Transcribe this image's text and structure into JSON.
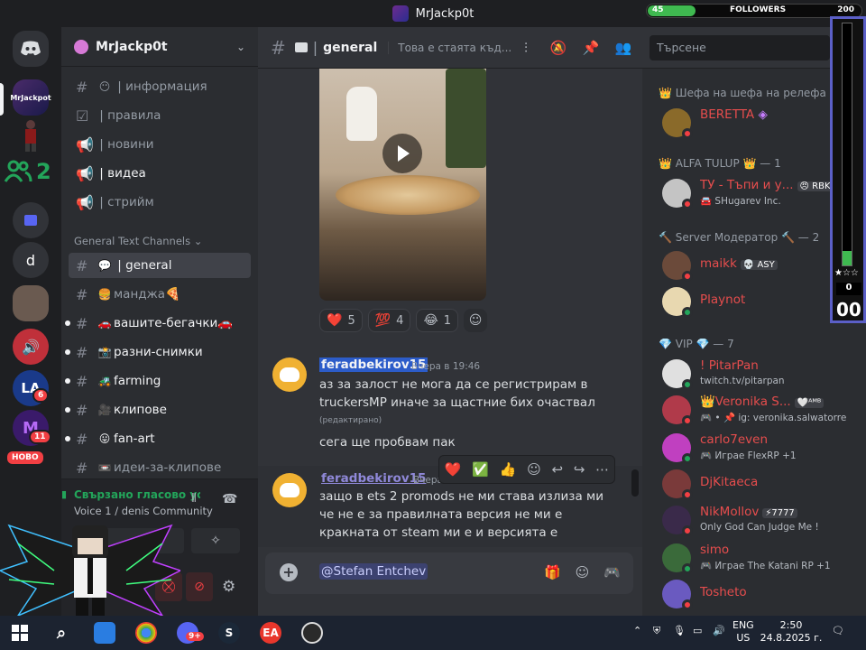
{
  "window": {
    "title": "MrJackp0t"
  },
  "followers_widget": {
    "current": "45",
    "label": "FOLLOWERS",
    "goal": "200",
    "progress": 0.225
  },
  "rail": {
    "servers": [
      {
        "name": "discord-home",
        "label": ""
      },
      {
        "name": "mrjackpot-server",
        "label": "MrJackpot"
      },
      {
        "name": "folder",
        "label": ""
      },
      {
        "name": "d-server",
        "label": "d"
      }
    ],
    "voice_count": "2",
    "badges": [
      "6",
      "11"
    ],
    "new_label": "НОВО"
  },
  "sidebar": {
    "guild_name": "MrJackp0t",
    "top_channels": [
      {
        "emoji": "😶",
        "label": "информация"
      },
      {
        "emoji": "☑",
        "label": "правила"
      },
      {
        "emoji": "📢",
        "label": "новини"
      },
      {
        "emoji": "📢",
        "label": "видеа"
      },
      {
        "emoji": "📢",
        "label": "стрийм"
      }
    ],
    "category": "General Text Channels",
    "text_channels": [
      {
        "emoji": "💬",
        "label": "general"
      },
      {
        "emoji": "🍔",
        "label": "манджа🍕"
      },
      {
        "emoji": "🚗",
        "label": "вашите-бегачки🚗"
      },
      {
        "emoji": "📸",
        "label": "разни-снимки"
      },
      {
        "emoji": "🚜",
        "label": "farming"
      },
      {
        "emoji": "🎥",
        "label": "клипове"
      },
      {
        "emoji": "😛",
        "label": "fan-art"
      },
      {
        "emoji": "📼",
        "label": "идеи-за-клипове"
      }
    ],
    "voice_status": "Свързано гласово устр",
    "voice_channel": "Voice 1 / denis Community"
  },
  "chat_header": {
    "channel": "general",
    "topic": "Това е стаята къд...",
    "search_placeholder": "Търсене"
  },
  "messages": {
    "reactions": [
      {
        "emoji": "❤️",
        "count": "5"
      },
      {
        "emoji": "💯",
        "count": "4"
      },
      {
        "emoji": "😂",
        "count": "1"
      }
    ],
    "m1": {
      "author": "feradbekirov15",
      "time": "Вчера в 19:46",
      "text": "аз за залост не мога да се регистрирам в truckersMP иначе за щастние бих очаствал",
      "edited": "(редактирано)",
      "text2": "сега ще пробвам пак"
    },
    "m2": {
      "author": "feradbekirov15",
      "time": "Вчера",
      "text": "защо в ets 2 promods не ми става излиза ми че не е за правилната версия не ми е кракната от steam ми е и версията е правилна"
    }
  },
  "composer": {
    "mention": "@Stefan Entchev"
  },
  "member_list": {
    "categories": [
      {
        "label": "👑 Шефа на шефа на релефа 👑"
      },
      {
        "label": "👑 ALFA TULUP 👑 — 1"
      },
      {
        "label": "🔨 Server Модератор 🔨 — 2"
      },
      {
        "label": "💎 VIP 💎 — 7"
      }
    ],
    "members": [
      {
        "name": "BERETTA",
        "sub": "",
        "tag": "",
        "avatar": "#8a6a2a",
        "status": "#f23f43"
      },
      {
        "name": "ТУ - Тъпи и у...",
        "sub": "🚘 SHugarev Inc.",
        "tag": "😠 RBK",
        "avatar": "#c4c4c4",
        "status": "#f23f43"
      },
      {
        "name": "maikk",
        "sub": "",
        "tag": "💀 ASY",
        "avatar": "#6b4a3a",
        "status": "#f23f43"
      },
      {
        "name": "Playnot",
        "sub": "",
        "tag": "",
        "avatar": "#e8d8b0",
        "status": "#23a55a"
      },
      {
        "name": "! PitarPan",
        "sub": "twitch.tv/pitarpan",
        "tag": "",
        "avatar": "#e0e0e0",
        "status": "#23a55a"
      },
      {
        "name": "👑Veronika S...",
        "sub": "🎮 • 📌 ig: veronika.salwatorre",
        "tag": "🤍ᴬᴹᴮ",
        "avatar": "#b03a4a",
        "status": "#f23f43"
      },
      {
        "name": "carlo7even",
        "sub": "🎮 Играе FlexRP +1",
        "tag": "",
        "avatar": "#c040c0",
        "status": "#23a55a"
      },
      {
        "name": "DjKitaeca",
        "sub": "",
        "tag": "",
        "avatar": "#7a3a3a",
        "status": "#f23f43"
      },
      {
        "name": "NikMollov",
        "sub": "Only God Can Judge Me !",
        "tag": "⚡7777",
        "avatar": "#3a2a4a",
        "status": "#f23f43"
      },
      {
        "name": "simo",
        "sub": "🎮 Играе The Katani RP +1",
        "tag": "",
        "avatar": "#3a6a3a",
        "status": "#23a55a"
      },
      {
        "name": "Tosheto",
        "sub": "",
        "tag": "",
        "avatar": "#6a5ac0",
        "status": "#f23f43"
      }
    ]
  },
  "stream_overlay": {
    "bar_level": 0.06,
    "zero": "0",
    "big": "00"
  },
  "taskbar": {
    "lang": "ENG",
    "region": "US",
    "time": "2:50",
    "date": "24.8.2025 г.",
    "discord_badge": "9+"
  },
  "colors": {
    "accent": "#5865f2",
    "online": "#23a55a",
    "dnd": "#f23f43"
  }
}
